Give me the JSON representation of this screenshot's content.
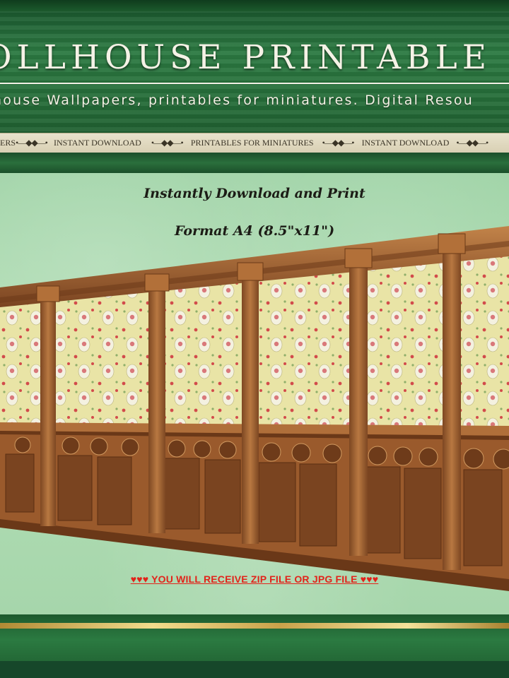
{
  "header": {
    "title": "OLLHOUSE PRINTABLE",
    "tagline": "house Wallpapers, printables for miniatures. Digital Resou",
    "ribbon": [
      "ERS",
      "INSTANT DOWNLOAD",
      "PRINTABLES FOR MINIATURES",
      "INSTANT DOWNLOAD"
    ]
  },
  "main": {
    "headline1": "Instantly Download and Print",
    "headline2": "Format A4 (8.5\"x11\")",
    "receive": "♥♥♥  YOU WILL RECEIVE  ZIP FILE OR JPG FILE ♥♥♥"
  },
  "colors": {
    "header_green": "#256c38",
    "panel_green": "#b4dfb7",
    "wood": "#9a5a2c",
    "wallpaper": "#e7e2a0",
    "alert_red": "#e2231a",
    "gold": "#e7c96e"
  }
}
